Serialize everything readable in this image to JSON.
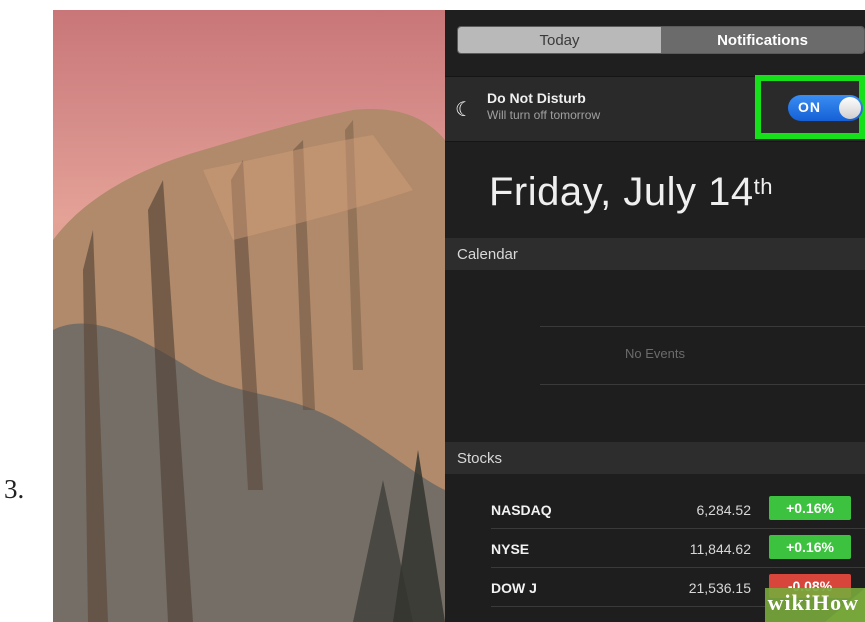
{
  "step_number": "3.",
  "tabs": [
    {
      "label": "Today"
    },
    {
      "label": "Notifications"
    }
  ],
  "do_not_disturb": {
    "icon": "moon-icon",
    "title": "Do Not Disturb",
    "subtitle": "Will turn off tomorrow",
    "toggle_label": "ON",
    "toggle_state": true
  },
  "date": {
    "text": "Friday, July 14",
    "suffix": "th"
  },
  "calendar": {
    "header": "Calendar",
    "empty_text": "No Events"
  },
  "stocks": {
    "header": "Stocks",
    "rows": [
      {
        "name": "NASDAQ",
        "price": "6,284.52",
        "change": "+0.16%",
        "direction": "up"
      },
      {
        "name": "NYSE",
        "price": "11,844.62",
        "change": "+0.16%",
        "direction": "up"
      },
      {
        "name": "DOW J",
        "price": "21,536.15",
        "change": "-0.08%",
        "direction": "down"
      }
    ]
  },
  "watermark": {
    "text": "wikiHow"
  },
  "colors": {
    "highlight": "#16e01a",
    "toggle_on": "#1f6fe0",
    "stock_up": "#3cc23f",
    "stock_down": "#d8453a"
  }
}
